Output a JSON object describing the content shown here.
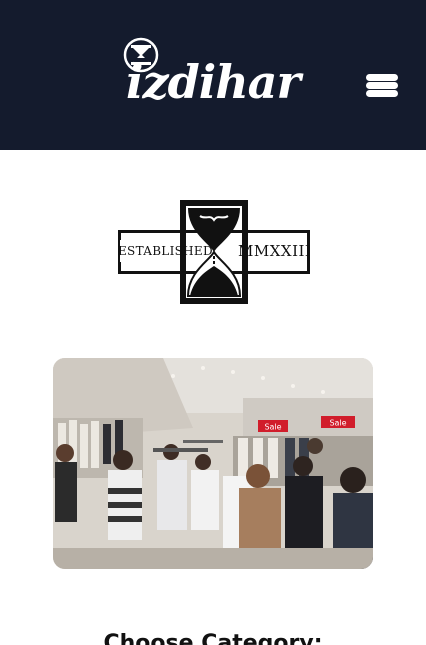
{
  "header": {
    "brand_name": "izdihar",
    "logo_icon": "hourglass-icon",
    "menu_icon": "hamburger-menu-icon",
    "background_color": "#141b2d"
  },
  "badge": {
    "left_text": "ESTABLISHED",
    "right_text": "MMXXIII",
    "icon": "hourglass-icon"
  },
  "photo": {
    "alt": "store interior with shoppers",
    "sale_sign_1": "Sale",
    "sale_sign_2": "Sale"
  },
  "section": {
    "title": "Choose Category:"
  }
}
